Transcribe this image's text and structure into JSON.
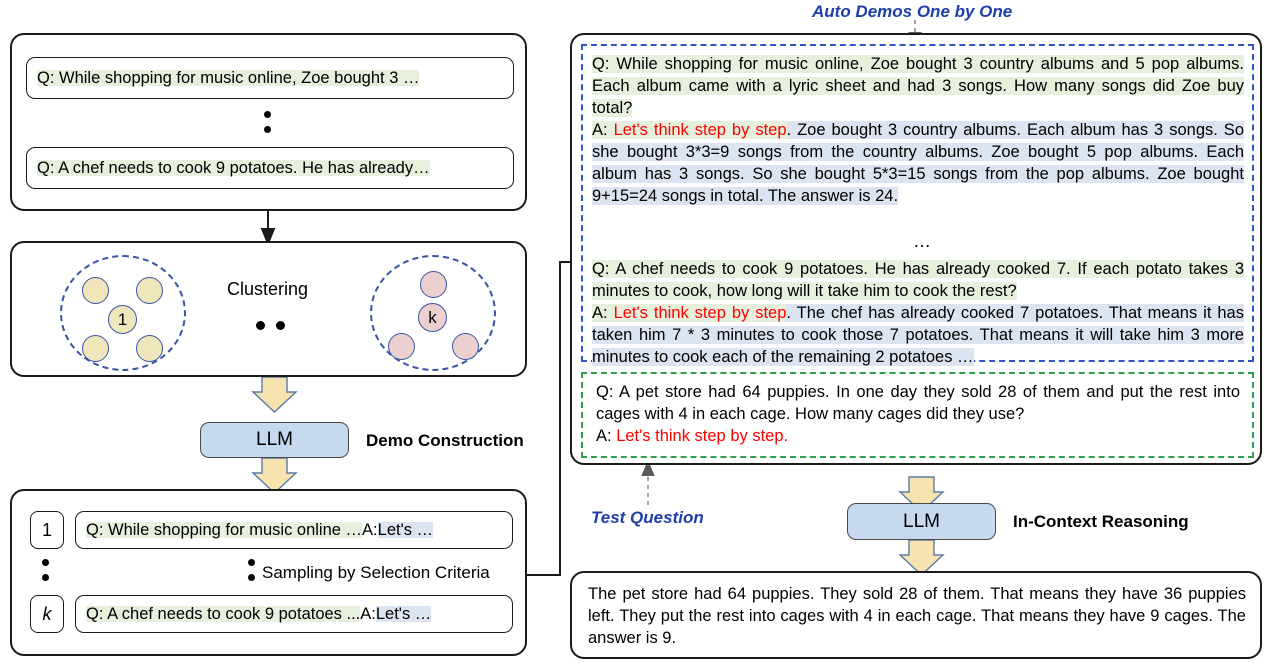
{
  "left": {
    "questions_box": {
      "items": [
        "Q: While shopping for music online, Zoe bought 3 …",
        "Q: A chef needs to cook 9 potatoes. He has already…"
      ]
    },
    "clustering": {
      "label": "Clustering",
      "cluster_first_label": "1",
      "cluster_last_label": "k"
    },
    "llm_demo": {
      "box_label": "LLM",
      "caption": "Demo Construction"
    },
    "sampling_box": {
      "caption": "Sampling by Selection Criteria",
      "rows": [
        {
          "index": "1",
          "q": "Q: While shopping for music online … ",
          "a_prefix": "A: ",
          "a_red": "Let's …"
        },
        {
          "index": "k",
          "q": "Q: A chef needs to cook 9 potatoes ... ",
          "a_prefix": "A: ",
          "a_red": "Let's …"
        }
      ]
    }
  },
  "right": {
    "auto_demos_label": "Auto Demos One by One",
    "test_question_label": "Test Question",
    "demos": [
      {
        "q": "Q: While shopping for music online, Zoe bought 3 country albums and 5 pop albums. Each album came with a lyric sheet and had 3 songs. How many songs did Zoe buy total?",
        "a_prefix": "A: ",
        "a_red": "Let's think step by step",
        "a_rest": ". Zoe bought 3 country albums. Each album has 3 songs. So she bought 3*3=9 songs from the country albums. Zoe bought 5 pop albums. Each album has 3 songs. So she bought 5*3=15 songs from the pop albums. Zoe bought 9+15=24 songs in total. The answer is 24."
      },
      {
        "q": "Q: A chef needs to cook 9 potatoes. He has already cooked 7. If each potato takes 3 minutes to cook, how long will it take him to cook the rest?",
        "a_prefix": "A: ",
        "a_red": "Let's think step by step",
        "a_rest": ". The chef has already cooked 7 potatoes. That means it has taken him 7 * 3 minutes to cook those 7 potatoes. That means it will take him 3 more minutes to cook each of the remaining 2 potatoes …"
      }
    ],
    "demos_ellipsis": "…",
    "test_question": {
      "q": "Q: A pet store had 64 puppies. In one day they sold 28 of them and put the rest into cages with 4 in each cage. How many cages did they use?",
      "a_prefix": "A: ",
      "a_red": "Let's think step by step."
    },
    "llm_reasoning": {
      "box_label": "LLM",
      "caption": "In-Context Reasoning"
    },
    "output": "The pet store had 64 puppies. They sold 28 of them. That means they have 36 puppies left. They put the rest into cages with 4 in each cage. That means they have 9 cages. The answer is 9."
  },
  "colors": {
    "question_highlight": "#e7efdd",
    "answer_highlight": "#dce4f2",
    "red_text": "#ff0000",
    "blue_label": "#1f3fa8",
    "llm_fill": "#c6d9ef",
    "cluster_stroke": "#3a55a4",
    "cluster_node_yellow": "#f0e6bb",
    "cluster_node_pink": "#eccfcf",
    "demo_border": "#3355cc",
    "test_border": "#2f9e4f",
    "arrow_fill": "#f6e3b0"
  }
}
